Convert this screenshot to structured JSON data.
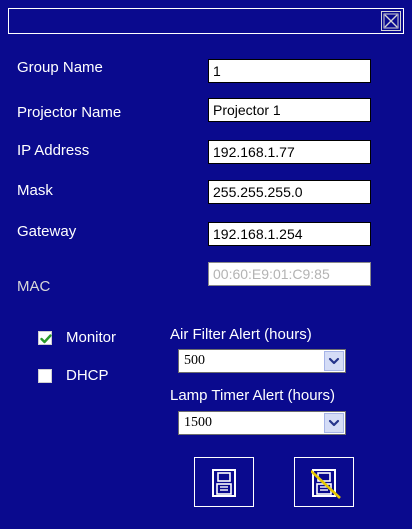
{
  "title_bar": {
    "close_icon": "close-icon"
  },
  "fields": {
    "group_name": {
      "label": "Group Name",
      "value": "1"
    },
    "projector_name": {
      "label": "Projector Name",
      "value": "Projector 1"
    },
    "ip_address": {
      "label": "IP Address",
      "value": "192.168.1.77"
    },
    "mask": {
      "label": "Mask",
      "value": "255.255.255.0"
    },
    "gateway": {
      "label": "Gateway",
      "value": "192.168.1.254"
    },
    "mac": {
      "label": "MAC",
      "value": "00:60:E9:01:C9:85"
    }
  },
  "options": {
    "monitor": {
      "label": "Monitor",
      "checked": true
    },
    "dhcp": {
      "label": "DHCP",
      "checked": false
    }
  },
  "alerts": {
    "air_filter": {
      "label": "Air Filter Alert (hours)",
      "selected": "500"
    },
    "lamp_timer": {
      "label": "Lamp Timer Alert (hours)",
      "selected": "1500"
    }
  },
  "actions": {
    "save_icon": "floppy-disk-icon",
    "discard_icon": "floppy-disk-crossed-icon"
  },
  "colors": {
    "background": "#0a0a8e",
    "text": "#ffffff",
    "check_green": "#2a9a2a",
    "cross_yellow": "#e6c800"
  }
}
